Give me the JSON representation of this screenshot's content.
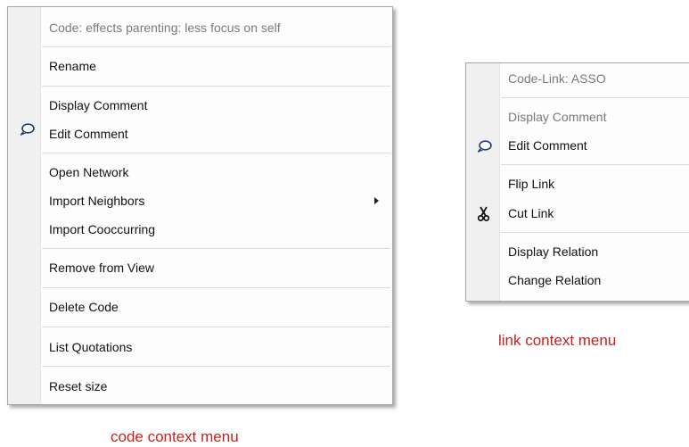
{
  "code_menu": {
    "header": "Code: effects parenting: less focus on self",
    "items": {
      "rename": "Rename",
      "display_comment": "Display Comment",
      "edit_comment": "Edit Comment",
      "open_network": "Open Network",
      "import_neighbors": "Import Neighbors",
      "import_cooccurring": "Import Cooccurring",
      "remove_from_view": "Remove from View",
      "delete_code": "Delete Code",
      "list_quotations": "List Quotations",
      "reset_size": "Reset size"
    },
    "icons": {
      "edit_comment": "speech-bubble-icon",
      "import_neighbors": "submenu-arrow-icon"
    }
  },
  "link_menu": {
    "header": "Code-Link: ASSO",
    "items": {
      "display_comment": "Display Comment",
      "edit_comment": "Edit Comment",
      "flip_link": "Flip Link",
      "cut_link": "Cut Link",
      "display_relation": "Display Relation",
      "change_relation": "Change Relation"
    },
    "icons": {
      "edit_comment": "speech-bubble-icon",
      "cut_link": "scissors-icon"
    }
  },
  "captions": {
    "code": "code context menu",
    "link": "link context menu"
  },
  "colors": {
    "caption": "#c8201a",
    "gutter": "#f0f0f0",
    "disabled_text": "#7a7a7a"
  }
}
